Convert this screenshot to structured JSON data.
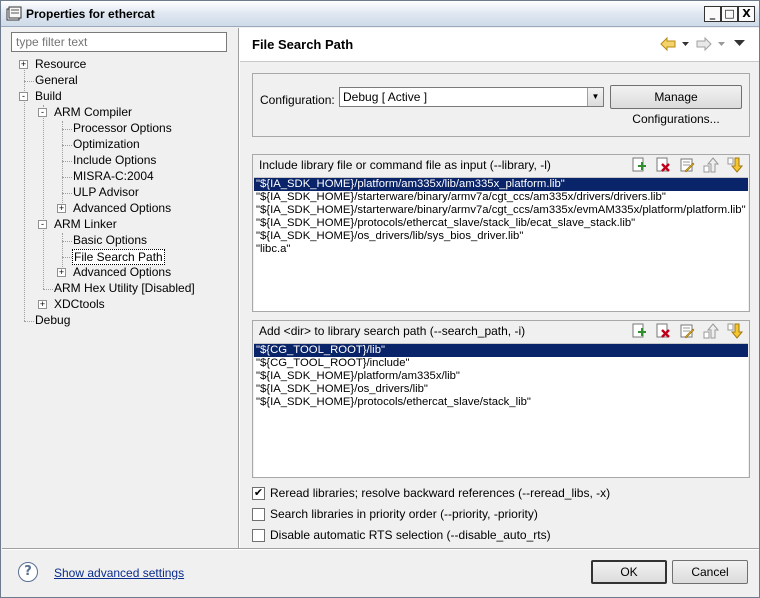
{
  "window": {
    "title": "Properties for ethercat",
    "controls": {
      "minimize": "_",
      "maximize": "□",
      "close": "X"
    }
  },
  "filter": {
    "placeholder": "type filter text",
    "value": ""
  },
  "tree": {
    "items": [
      {
        "label": "Resource",
        "expander": "+"
      },
      {
        "label": "General"
      },
      {
        "label": "Build",
        "expander": "-"
      },
      {
        "label": "ARM Compiler",
        "expander": "-"
      },
      {
        "label": "Processor Options"
      },
      {
        "label": "Optimization"
      },
      {
        "label": "Include Options"
      },
      {
        "label": "MISRA-C:2004"
      },
      {
        "label": "ULP Advisor"
      },
      {
        "label": "Advanced Options",
        "expander": "+"
      },
      {
        "label": "ARM Linker",
        "expander": "-"
      },
      {
        "label": "Basic Options"
      },
      {
        "label": "File Search Path",
        "selected": true
      },
      {
        "label": "Advanced Options",
        "expander": "+"
      },
      {
        "label": "ARM Hex Utility  [Disabled]"
      },
      {
        "label": "XDCtools",
        "expander": "+"
      },
      {
        "label": "Debug"
      }
    ]
  },
  "header": {
    "page_title": "File Search Path",
    "nav_icons": [
      "back-arrow-icon",
      "dropdown-icon",
      "forward-arrow-icon",
      "dropdown-icon",
      "view-menu-icon"
    ]
  },
  "configuration": {
    "label": "Configuration:",
    "value": "Debug  [ Active ]",
    "manage_button": "Manage Configurations..."
  },
  "library_group": {
    "label": "Include library file or command file as input (--library, -l)",
    "items": [
      "\"${IA_SDK_HOME}/platform/am335x/lib/am335x_platform.lib\"",
      "\"${IA_SDK_HOME}/starterware/binary/armv7a/cgt_ccs/am335x/drivers/drivers.lib\"",
      "\"${IA_SDK_HOME}/starterware/binary/armv7a/cgt_ccs/am335x/evmAM335x/platform/platform.lib\"",
      "\"${IA_SDK_HOME}/protocols/ethercat_slave/stack_lib/ecat_slave_stack.lib\"",
      "\"${IA_SDK_HOME}/os_drivers/lib/sys_bios_driver.lib\"",
      "\"libc.a\""
    ],
    "selected_index": 0
  },
  "search_path_group": {
    "label": "Add <dir> to library search path (--search_path, -i)",
    "items": [
      "\"${CG_TOOL_ROOT}/lib\"",
      "\"${CG_TOOL_ROOT}/include\"",
      "\"${IA_SDK_HOME}/platform/am335x/lib\"",
      "\"${IA_SDK_HOME}/os_drivers/lib\"",
      "\"${IA_SDK_HOME}/protocols/ethercat_slave/stack_lib\""
    ],
    "selected_index": 0
  },
  "list_tools": [
    "add-icon",
    "delete-icon",
    "edit-icon",
    "move-up-icon",
    "move-down-icon"
  ],
  "options": [
    {
      "label": "Reread libraries; resolve backward references (--reread_libs, -x)",
      "checked": true
    },
    {
      "label": "Search libraries in priority order (--priority, -priority)",
      "checked": false
    },
    {
      "label": "Disable automatic RTS selection (--disable_auto_rts)",
      "checked": false
    }
  ],
  "footer": {
    "help_icon": "?",
    "advanced_link": "Show advanced settings",
    "ok_label": "OK",
    "cancel_label": "Cancel"
  },
  "colors": {
    "selection": "#0a246a",
    "link": "#0a2c8c",
    "delete_red": "#c0001a",
    "add_green": "#2f8f2f",
    "nav_yellow": "#e8b020"
  }
}
